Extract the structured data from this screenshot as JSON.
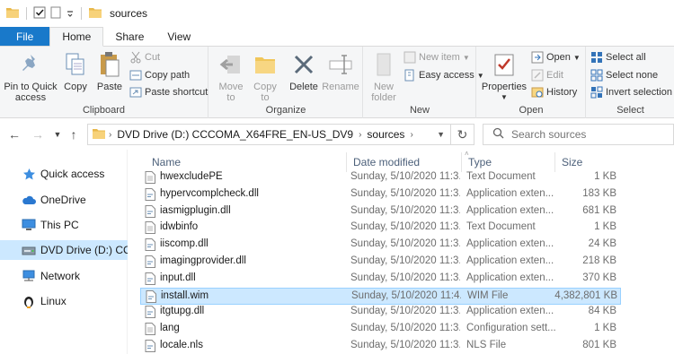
{
  "window": {
    "title": "sources"
  },
  "tabs": [
    {
      "label": "File"
    },
    {
      "label": "Home"
    },
    {
      "label": "Share"
    },
    {
      "label": "View"
    }
  ],
  "ribbon": {
    "clipboard": {
      "label": "Clipboard",
      "pin": "Pin to Quick",
      "pin2": "access",
      "copy": "Copy",
      "paste": "Paste",
      "cut": "Cut",
      "copy_path": "Copy path",
      "paste_shortcut": "Paste shortcut"
    },
    "organize": {
      "label": "Organize",
      "move": "Move",
      "move2": "to",
      "copy": "Copy",
      "copy2": "to",
      "delete": "Delete",
      "rename": "Rename"
    },
    "new": {
      "label": "New",
      "new_folder": "New",
      "new_folder2": "folder",
      "new_item": "New item",
      "easy_access": "Easy access"
    },
    "open": {
      "label": "Open",
      "properties": "Properties",
      "open": "Open",
      "edit": "Edit",
      "history": "History"
    },
    "select": {
      "label": "Select",
      "select_all": "Select all",
      "select_none": "Select none",
      "invert": "Invert selection"
    }
  },
  "address": {
    "crumbs": [
      "DVD Drive (D:) CCCOMA_X64FRE_EN-US_DV9",
      "sources"
    ],
    "search_placeholder": "Search sources"
  },
  "nav": {
    "items": [
      {
        "label": "Quick access",
        "icon": "star-icon"
      },
      {
        "label": "OneDrive",
        "icon": "cloud-icon"
      },
      {
        "label": "This PC",
        "icon": "computer-icon"
      },
      {
        "label": "DVD Drive (D:) CCCO",
        "icon": "dvd-drive-icon"
      },
      {
        "label": "Network",
        "icon": "network-icon"
      },
      {
        "label": "Linux",
        "icon": "penguin-icon"
      }
    ]
  },
  "columns": {
    "name": "Name",
    "date": "Date modified",
    "type": "Type",
    "size": "Size"
  },
  "files": [
    {
      "name": "hwexcludePE",
      "date": "Sunday, 5/10/2020 11:3...",
      "type": "Text Document",
      "size": "1 KB"
    },
    {
      "name": "hypervcomplcheck.dll",
      "date": "Sunday, 5/10/2020 11:3...",
      "type": "Application exten...",
      "size": "183 KB"
    },
    {
      "name": "iasmigplugin.dll",
      "date": "Sunday, 5/10/2020 11:3...",
      "type": "Application exten...",
      "size": "681 KB"
    },
    {
      "name": "idwbinfo",
      "date": "Sunday, 5/10/2020 11:3...",
      "type": "Text Document",
      "size": "1 KB"
    },
    {
      "name": "iiscomp.dll",
      "date": "Sunday, 5/10/2020 11:3...",
      "type": "Application exten...",
      "size": "24 KB"
    },
    {
      "name": "imagingprovider.dll",
      "date": "Sunday, 5/10/2020 11:3...",
      "type": "Application exten...",
      "size": "218 KB"
    },
    {
      "name": "input.dll",
      "date": "Sunday, 5/10/2020 11:3...",
      "type": "Application exten...",
      "size": "370 KB"
    },
    {
      "name": "install.wim",
      "date": "Sunday, 5/10/2020 11:4...",
      "type": "WIM File",
      "size": "4,382,801 KB"
    },
    {
      "name": "itgtupg.dll",
      "date": "Sunday, 5/10/2020 11:3...",
      "type": "Application exten...",
      "size": "84 KB"
    },
    {
      "name": "lang",
      "date": "Sunday, 5/10/2020 11:3...",
      "type": "Configuration sett...",
      "size": "1 KB"
    },
    {
      "name": "locale.nls",
      "date": "Sunday, 5/10/2020 11:3...",
      "type": "NLS File",
      "size": "801 KB"
    }
  ]
}
